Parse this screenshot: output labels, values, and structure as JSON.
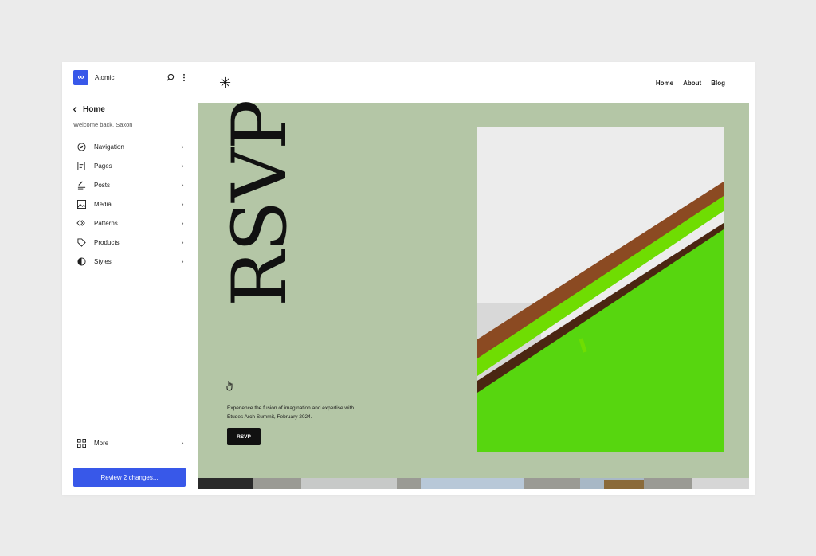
{
  "site": {
    "name": "Atomic",
    "logo_glyph": "∞",
    "brand_color": "#3858e9"
  },
  "sidebar": {
    "back_title": "Home",
    "welcome": "Welcome back, Saxon",
    "items": [
      {
        "label": "Navigation",
        "icon": "compass-icon"
      },
      {
        "label": "Pages",
        "icon": "page-icon"
      },
      {
        "label": "Posts",
        "icon": "posts-icon"
      },
      {
        "label": "Media",
        "icon": "image-icon"
      },
      {
        "label": "Patterns",
        "icon": "patterns-icon"
      },
      {
        "label": "Products",
        "icon": "tag-icon"
      },
      {
        "label": "Styles",
        "icon": "contrast-icon"
      }
    ],
    "more_label": "More",
    "review_label": "Review 2 changes..."
  },
  "preview": {
    "logo_glyph": "✳",
    "menu": [
      "Home",
      "About",
      "Blog"
    ],
    "hero_title": "RSVP",
    "description": "Experience the fusion of imagination and expertise with Études Arch Summit, February 2024.",
    "cta_label": "RSVP",
    "background_color": "#b4c6a6"
  }
}
